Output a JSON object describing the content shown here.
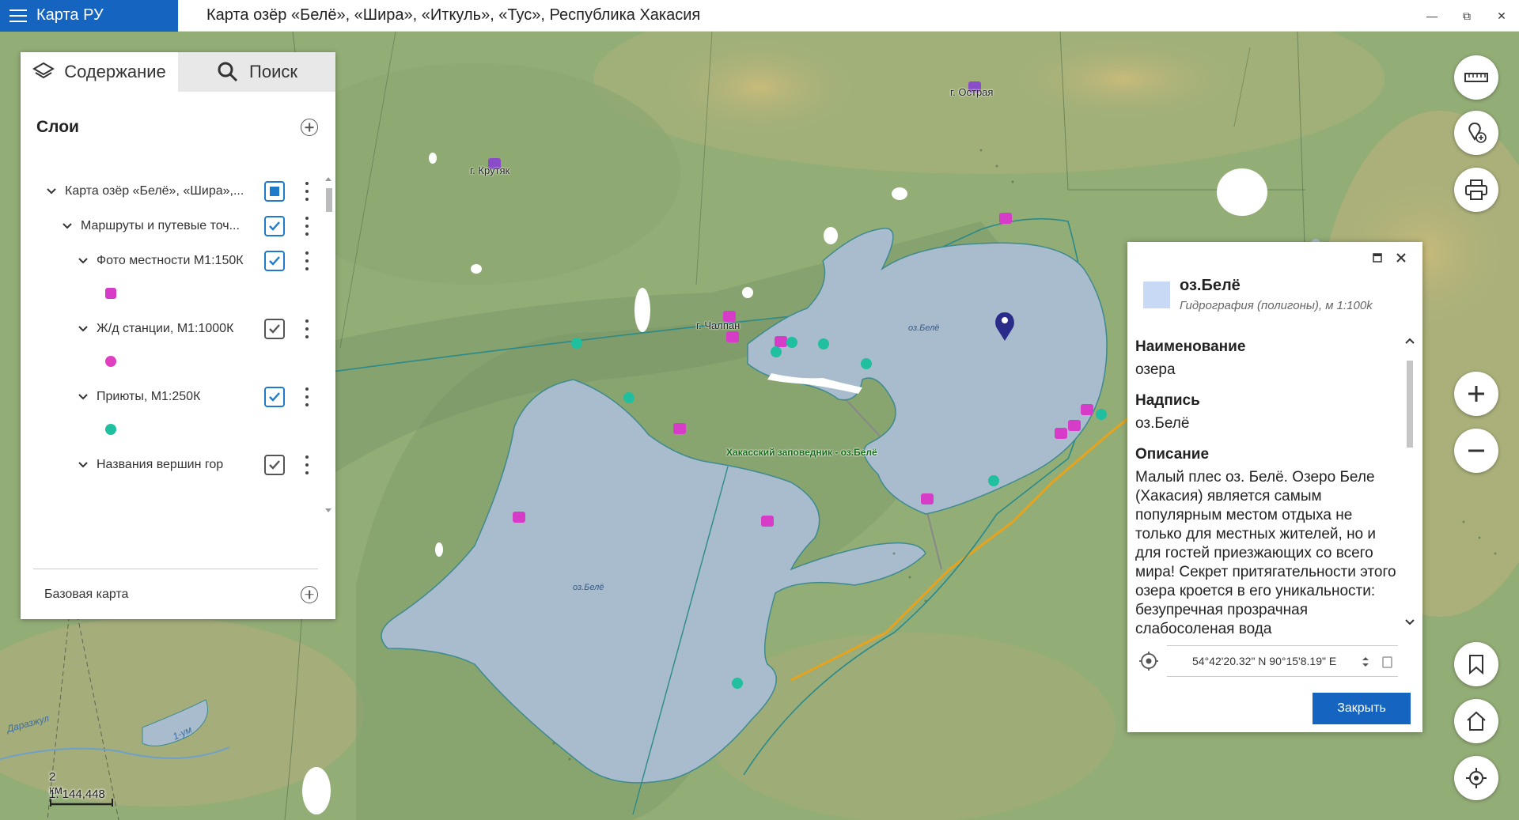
{
  "app": {
    "name": "Карта РУ"
  },
  "window": {
    "title": "Карта озёр «Белё», «Шира», «Иткуль», «Тус», Республика Хакасия",
    "minimize": "—",
    "restore": "⧉",
    "close": "✕"
  },
  "left_panel": {
    "tabs": [
      {
        "label": "Содержание",
        "active": true
      },
      {
        "label": "Поиск",
        "active": false
      }
    ],
    "layers_title": "Слои",
    "tree": [
      {
        "label": "Карта озёр «Белё», «Шира»,...",
        "state": "partial",
        "level": 0
      },
      {
        "label": "Маршруты и путевые точ...",
        "state": "checked",
        "level": 1
      },
      {
        "label": "Фото местности М1:150К",
        "state": "checked",
        "level": 2,
        "legend_color": "#d63cc8"
      },
      {
        "label": "Ж/д станции, М1:1000К",
        "state": "checked_gray",
        "level": 2,
        "legend_color": "#e040c0"
      },
      {
        "label": "Приюты, М1:250К",
        "state": "checked",
        "level": 2,
        "legend_color": "#1fbfa0"
      },
      {
        "label": "Названия вершин гор",
        "state": "checked_gray",
        "level": 2
      }
    ],
    "basemap_label": "Базовая карта"
  },
  "map_labels": {
    "peak_krutyak": "г. Крутяк",
    "peak_ostraya": "г. Острая",
    "peak_chalpan": "г. Чалпан",
    "lake_north": "оз.Белё",
    "lake_south": "оз.Белё",
    "reserve": "Хакасский заповедник - оз.Белё",
    "river": "1-ум",
    "river2": "Даразжул"
  },
  "scale": {
    "distance": "2 км",
    "ratio": "1: 144,448"
  },
  "info_popup": {
    "title": "оз.Белё",
    "subtitle": "Гидрография (полигоны), м 1:100k",
    "swatch_color": "#c8d9f5",
    "fields": [
      {
        "name": "Наименование",
        "value": "озера"
      },
      {
        "name": "Надпись",
        "value": "оз.Белё"
      },
      {
        "name": "Описание",
        "value": "Малый плес оз. Белё. Озеро Беле (Хакасия) является самым популярным местом отдыха не только для местных жителей, но и для гостей приезжающих со всего мира! Секрет притягательности этого озера кроется в его уникальности: безупречная прозрачная слабосоленая вода"
      }
    ],
    "coordinates": "54°42'20.32\" N 90°15'8.19\" E",
    "close_label": "Закрыть"
  },
  "colors": {
    "accent": "#1565c0",
    "lake": "#a9bccc",
    "forest": "#7a9a6a",
    "marker": "#2b2b8a"
  }
}
